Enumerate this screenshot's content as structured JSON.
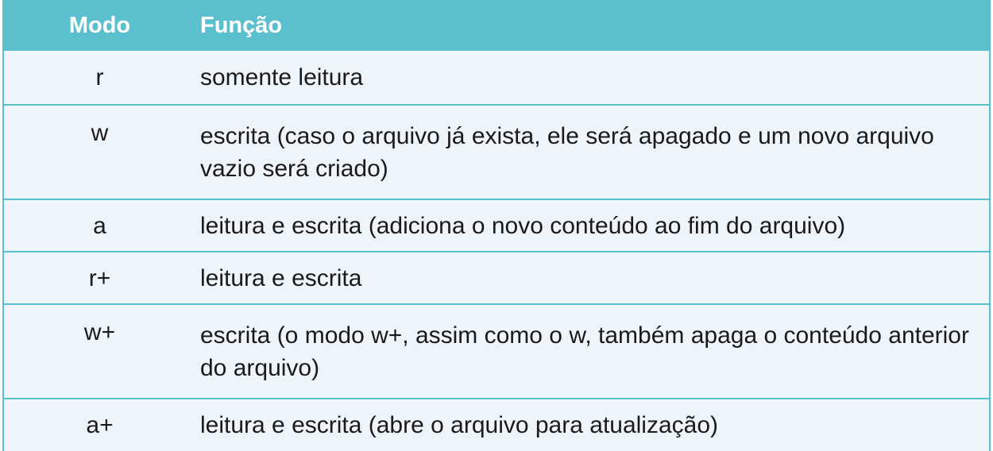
{
  "table": {
    "header": {
      "mode": "Modo",
      "function": "Função"
    },
    "rows": [
      {
        "mode": "r",
        "function": "somente leitura"
      },
      {
        "mode": "w",
        "function": "escrita (caso o arquivo já exista, ele será apagado e um novo arquivo vazio será criado)"
      },
      {
        "mode": "a",
        "function": "leitura e escrita (adiciona o novo conteúdo ao fim do arquivo)"
      },
      {
        "mode": "r+",
        "function": "leitura e escrita"
      },
      {
        "mode": "w+",
        "function": "escrita (o modo w+, assim como o w, também apaga o conteúdo anterior do arquivo)"
      },
      {
        "mode": "a+",
        "function": "leitura e escrita (abre o arquivo para atualização)"
      }
    ],
    "colors": {
      "header_bg": "#5bc0ce",
      "row_bg": "#eef5fa",
      "border": "#5bc0ce",
      "text": "#1a1a1a",
      "header_text": "#ffffff"
    }
  }
}
